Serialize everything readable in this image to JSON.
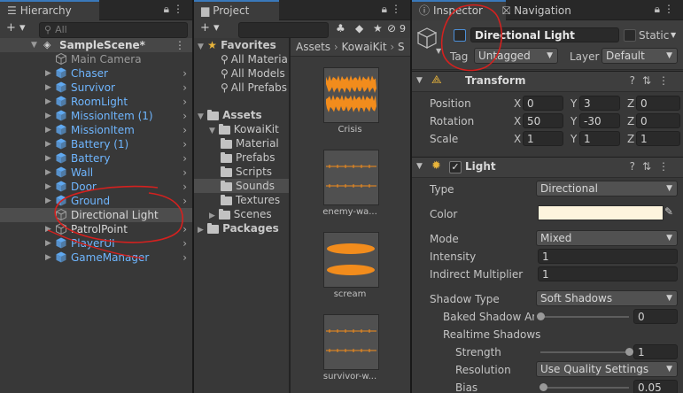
{
  "hierarchy": {
    "tab": "Hierarchy",
    "add_label": "+ ▾",
    "search_placeholder": "All",
    "scene": "SampleScene*",
    "items": [
      {
        "label": "Main Camera",
        "color": "#9a9a9a",
        "blue": false,
        "expand": false
      },
      {
        "label": "Chaser",
        "color": "#6fb6ff",
        "blue": true,
        "expand": true
      },
      {
        "label": "Survivor",
        "color": "#6fb6ff",
        "blue": true,
        "expand": true
      },
      {
        "label": "RoomLight",
        "color": "#6fb6ff",
        "blue": true,
        "expand": true
      },
      {
        "label": "MissionItem (1)",
        "color": "#6fb6ff",
        "blue": true,
        "expand": true
      },
      {
        "label": "MissionItem",
        "color": "#6fb6ff",
        "blue": true,
        "expand": true
      },
      {
        "label": "Battery (1)",
        "color": "#6fb6ff",
        "blue": true,
        "expand": true
      },
      {
        "label": "Battery",
        "color": "#6fb6ff",
        "blue": true,
        "expand": true
      },
      {
        "label": "Wall",
        "color": "#6fb6ff",
        "blue": true,
        "expand": true
      },
      {
        "label": "Door",
        "color": "#6fb6ff",
        "blue": true,
        "expand": true
      },
      {
        "label": "Ground",
        "color": "#6fb6ff",
        "blue": true,
        "expand": true
      },
      {
        "label": "Directional Light",
        "color": "#d8d8d8",
        "blue": false,
        "expand": false
      },
      {
        "label": "PatrolPoint",
        "color": "#d8d8d8",
        "blue": false,
        "expand": true
      },
      {
        "label": "PlayerUI",
        "color": "#6fb6ff",
        "blue": true,
        "expand": true
      },
      {
        "label": "GameManager",
        "color": "#6fb6ff",
        "blue": true,
        "expand": true
      }
    ]
  },
  "project": {
    "tab": "Project",
    "add_label": "+ ▾",
    "hidden_count": "9",
    "favorites_label": "Favorites",
    "favorites": [
      "All Materia",
      "All Models",
      "All Prefabs"
    ],
    "assets_label": "Assets",
    "kowaikit_label": "KowaiKit",
    "kowaikit_children": [
      "Material",
      "Prefabs",
      "Scripts",
      "Sounds",
      "Textures"
    ],
    "scenes_label": "Scenes",
    "packages_label": "Packages",
    "breadcrumb": [
      "Assets",
      "KowaiKit",
      "S"
    ],
    "files": [
      {
        "name": "Crisis",
        "style": "full"
      },
      {
        "name": "enemy-wa...",
        "style": "flat"
      },
      {
        "name": "scream",
        "style": "blob"
      },
      {
        "name": "survivor-w...",
        "style": "flat"
      }
    ]
  },
  "inspector": {
    "tab": "Inspector",
    "nav_tab": "Navigation",
    "object_name": "Directional Light",
    "static_label": "Static",
    "tag_label": "Tag",
    "tag_value": "Untagged",
    "layer_label": "Layer",
    "layer_value": "Default",
    "transform": {
      "title": "Transform",
      "position_label": "Position",
      "position": [
        "0",
        "3",
        "0"
      ],
      "rotation_label": "Rotation",
      "rotation": [
        "50",
        "-30",
        "0"
      ],
      "scale_label": "Scale",
      "scale": [
        "1",
        "1",
        "1"
      ],
      "axes": [
        "X",
        "Y",
        "Z"
      ]
    },
    "light": {
      "title": "Light",
      "type_label": "Type",
      "type_value": "Directional",
      "color_label": "Color",
      "color_value": "#fdf4dd",
      "mode_label": "Mode",
      "mode_value": "Mixed",
      "intensity_label": "Intensity",
      "intensity_value": "1",
      "indirect_label": "Indirect Multiplier",
      "indirect_value": "1",
      "shadow_type_label": "Shadow Type",
      "shadow_type_value": "Soft Shadows",
      "baked_label": "Baked Shadow An",
      "baked_value": "0",
      "baked_fraction": 0,
      "realtime_label": "Realtime Shadows",
      "strength_label": "Strength",
      "strength_value": "1",
      "strength_fraction": 1,
      "resolution_label": "Resolution",
      "resolution_value": "Use Quality Settings",
      "bias_label": "Bias",
      "bias_value": "0.05",
      "bias_fraction": 0.025
    }
  },
  "colors": {
    "accent": "#3a79bb",
    "blue_object": "#6fb6ff",
    "audio_waveform": "#f28c1c",
    "annotation": "#d4211f"
  }
}
